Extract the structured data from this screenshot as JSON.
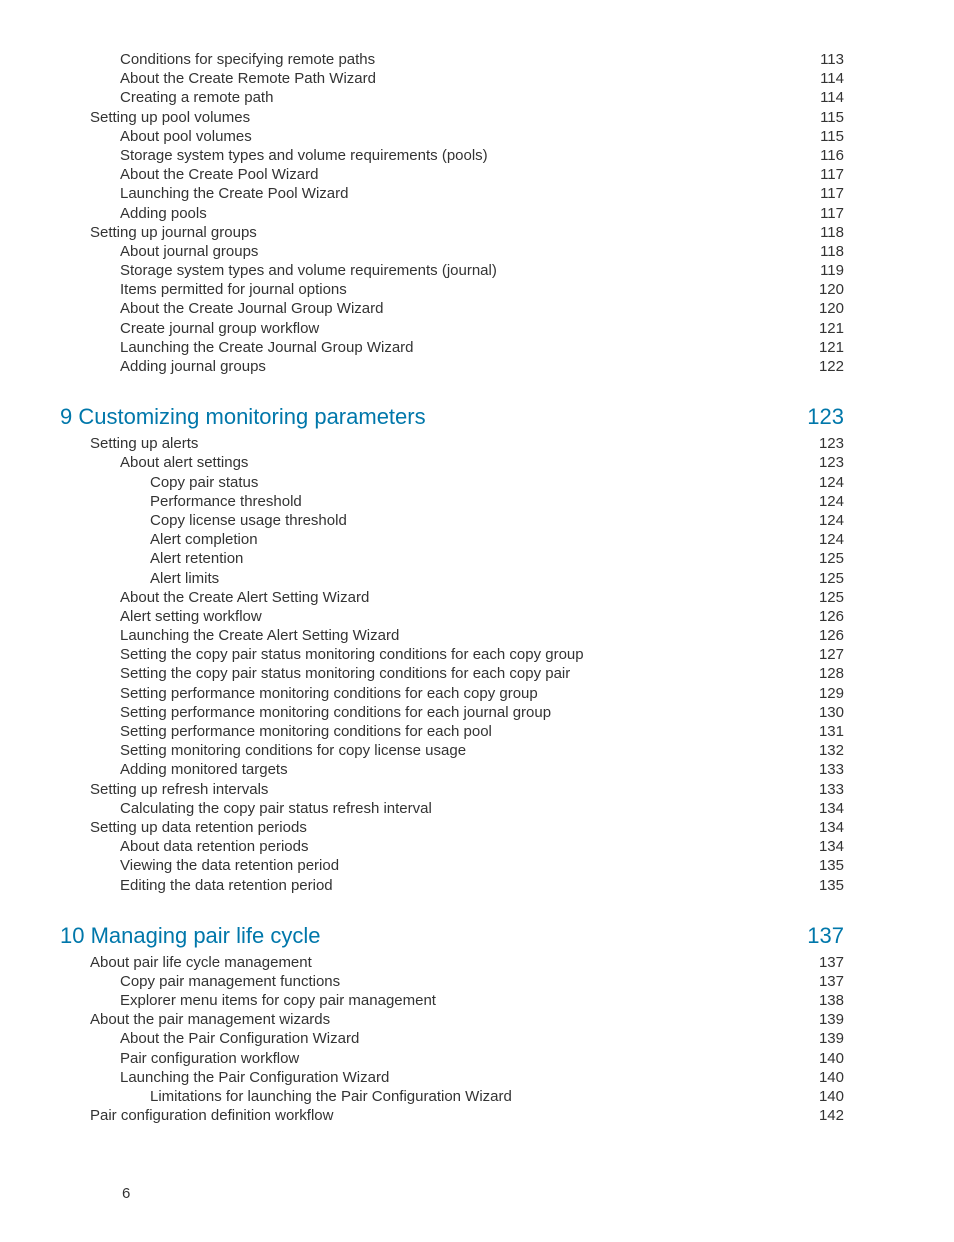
{
  "footer_page_number": "6",
  "toc": [
    {
      "type": "entry",
      "indent": 1,
      "label": "Conditions for specifying remote paths",
      "page": "113"
    },
    {
      "type": "entry",
      "indent": 1,
      "label": "About the Create Remote Path Wizard",
      "page": "114"
    },
    {
      "type": "entry",
      "indent": 1,
      "label": "Creating a remote path",
      "page": "114"
    },
    {
      "type": "entry",
      "indent": 0,
      "label": "Setting up pool volumes",
      "page": "115"
    },
    {
      "type": "entry",
      "indent": 1,
      "label": "About pool volumes",
      "page": "115"
    },
    {
      "type": "entry",
      "indent": 1,
      "label": "Storage system types and volume requirements (pools)",
      "page": "116"
    },
    {
      "type": "entry",
      "indent": 1,
      "label": "About the Create Pool Wizard",
      "page": "117"
    },
    {
      "type": "entry",
      "indent": 1,
      "label": "Launching the Create Pool Wizard",
      "page": "117"
    },
    {
      "type": "entry",
      "indent": 1,
      "label": "Adding pools",
      "page": "117"
    },
    {
      "type": "entry",
      "indent": 0,
      "label": "Setting up journal groups",
      "page": "118"
    },
    {
      "type": "entry",
      "indent": 1,
      "label": "About journal groups",
      "page": "118"
    },
    {
      "type": "entry",
      "indent": 1,
      "label": "Storage system types and volume requirements (journal)",
      "page": "119"
    },
    {
      "type": "entry",
      "indent": 1,
      "label": "Items permitted for journal options",
      "page": "120"
    },
    {
      "type": "entry",
      "indent": 1,
      "label": "About the Create Journal Group Wizard",
      "page": "120"
    },
    {
      "type": "entry",
      "indent": 1,
      "label": "Create journal group workflow",
      "page": "121"
    },
    {
      "type": "entry",
      "indent": 1,
      "label": "Launching the Create Journal Group Wizard",
      "page": "121"
    },
    {
      "type": "entry",
      "indent": 1,
      "label": "Adding journal groups",
      "page": "122"
    },
    {
      "type": "chapter",
      "label": "9 Customizing monitoring parameters",
      "page": "123"
    },
    {
      "type": "entry",
      "indent": 0,
      "label": "Setting up alerts",
      "page": "123"
    },
    {
      "type": "entry",
      "indent": 1,
      "label": "About alert settings",
      "page": "123"
    },
    {
      "type": "entry",
      "indent": 2,
      "label": "Copy pair status",
      "page": "124"
    },
    {
      "type": "entry",
      "indent": 2,
      "label": "Performance threshold",
      "page": "124"
    },
    {
      "type": "entry",
      "indent": 2,
      "label": "Copy license usage threshold",
      "page": "124"
    },
    {
      "type": "entry",
      "indent": 2,
      "label": "Alert completion",
      "page": "124"
    },
    {
      "type": "entry",
      "indent": 2,
      "label": "Alert retention",
      "page": "125"
    },
    {
      "type": "entry",
      "indent": 2,
      "label": "Alert limits",
      "page": "125"
    },
    {
      "type": "entry",
      "indent": 1,
      "label": "About the Create Alert Setting Wizard",
      "page": "125"
    },
    {
      "type": "entry",
      "indent": 1,
      "label": "Alert setting workflow ",
      "page": "126"
    },
    {
      "type": "entry",
      "indent": 1,
      "label": "Launching the Create Alert Setting Wizard",
      "page": "126"
    },
    {
      "type": "entry",
      "indent": 1,
      "label": "Setting the copy pair status monitoring conditions for each copy group",
      "page": "127"
    },
    {
      "type": "entry",
      "indent": 1,
      "label": "Setting the copy pair status monitoring conditions for each copy pair",
      "page": "128"
    },
    {
      "type": "entry",
      "indent": 1,
      "label": "Setting performance monitoring conditions for each copy group",
      "page": "129"
    },
    {
      "type": "entry",
      "indent": 1,
      "label": "Setting performance monitoring conditions for each journal group",
      "page": "130"
    },
    {
      "type": "entry",
      "indent": 1,
      "label": "Setting performance monitoring conditions for each pool",
      "page": "131"
    },
    {
      "type": "entry",
      "indent": 1,
      "label": "Setting monitoring conditions for copy license usage",
      "page": "132"
    },
    {
      "type": "entry",
      "indent": 1,
      "label": "Adding monitored targets",
      "page": "133"
    },
    {
      "type": "entry",
      "indent": 0,
      "label": "Setting up refresh intervals",
      "page": "133"
    },
    {
      "type": "entry",
      "indent": 1,
      "label": "Calculating the copy pair status refresh interval",
      "page": "134"
    },
    {
      "type": "entry",
      "indent": 0,
      "label": "Setting up data retention periods",
      "page": "134"
    },
    {
      "type": "entry",
      "indent": 1,
      "label": "About data retention periods",
      "page": "134"
    },
    {
      "type": "entry",
      "indent": 1,
      "label": "Viewing the data retention period",
      "page": "135"
    },
    {
      "type": "entry",
      "indent": 1,
      "label": "Editing the data retention period",
      "page": "135"
    },
    {
      "type": "chapter",
      "label": "10 Managing pair life cycle",
      "page": "137"
    },
    {
      "type": "entry",
      "indent": 0,
      "label": "About pair life cycle management",
      "page": "137"
    },
    {
      "type": "entry",
      "indent": 1,
      "label": "Copy pair management functions",
      "page": "137"
    },
    {
      "type": "entry",
      "indent": 1,
      "label": "Explorer menu items for copy pair management ",
      "page": "138"
    },
    {
      "type": "entry",
      "indent": 0,
      "label": "About the pair management wizards",
      "page": "139"
    },
    {
      "type": "entry",
      "indent": 1,
      "label": "About the Pair Configuration Wizard",
      "page": "139"
    },
    {
      "type": "entry",
      "indent": 1,
      "label": "Pair configuration workflow",
      "page": "140"
    },
    {
      "type": "entry",
      "indent": 1,
      "label": "Launching the Pair Configuration Wizard",
      "page": "140"
    },
    {
      "type": "entry",
      "indent": 2,
      "label": "Limitations for launching the Pair Configuration Wizard",
      "page": "140"
    },
    {
      "type": "entry",
      "indent": 0,
      "label": "Pair configuration definition workflow",
      "page": "142"
    }
  ]
}
